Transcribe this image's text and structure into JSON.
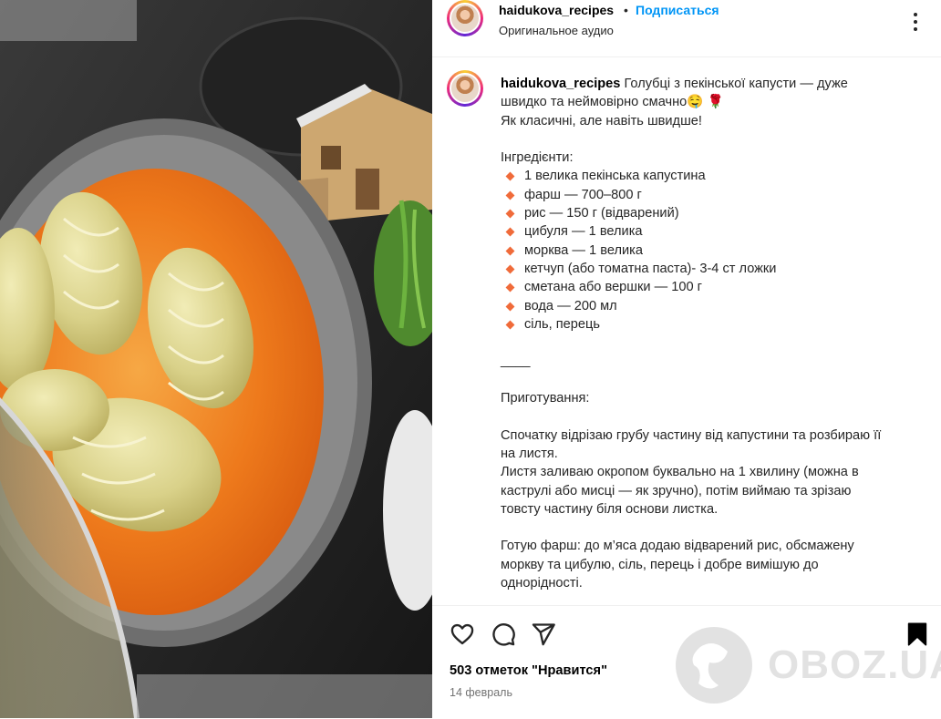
{
  "post": {
    "username": "haidukova_recipes",
    "separator": "•",
    "follow_label": "Подписаться",
    "audio_label": "Оригинальное аудио"
  },
  "caption": {
    "username": "haidukova_recipes",
    "line1": "Голубці з пекінської капусти — дуже швидко та неймовірно смачно🤤 🌹",
    "line2": "Як класичні, але навіть швидше!",
    "ingredients_title": "Інгредієнти:",
    "ingredients": [
      "1 велика пекінська капустина",
      "фарш — 700–800 г",
      "рис — 150 г (відварений)",
      "цибуля — 1 велика",
      "морква — 1 велика",
      "кетчуп (або томатна паста)- 3-4 ст ложки",
      "сметана або вершки — 100 г",
      "вода — 200 мл",
      "сіль, перець"
    ],
    "divider": "____",
    "prep_title": "Приготування:",
    "step1": "Спочатку відрізаю грубу частину від капустини та розбираю її на листя.",
    "step2": "Листя заливаю окропом буквально на 1 хвилину (можна в каструлі або мисці — як зручно), потім виймаю та зрізаю товсту частину біля основи листка.",
    "step3": "Готую фарш: до м’яса додаю відварений рис, обсмажену моркву та цибулю, сіль, перець і добре вимішую до однорідності."
  },
  "footer": {
    "likes": "503 отметок \"Нравится\"",
    "date": "14 февраль"
  },
  "watermark": {
    "text": "OBOZ.UA"
  },
  "icons": {
    "close": "close-icon",
    "like": "heart-icon",
    "comment": "comment-icon",
    "share": "share-icon",
    "save": "bookmark-icon"
  },
  "colors": {
    "follow": "#0095f6",
    "bullet": "#f06b3a",
    "muted": "#737373"
  }
}
